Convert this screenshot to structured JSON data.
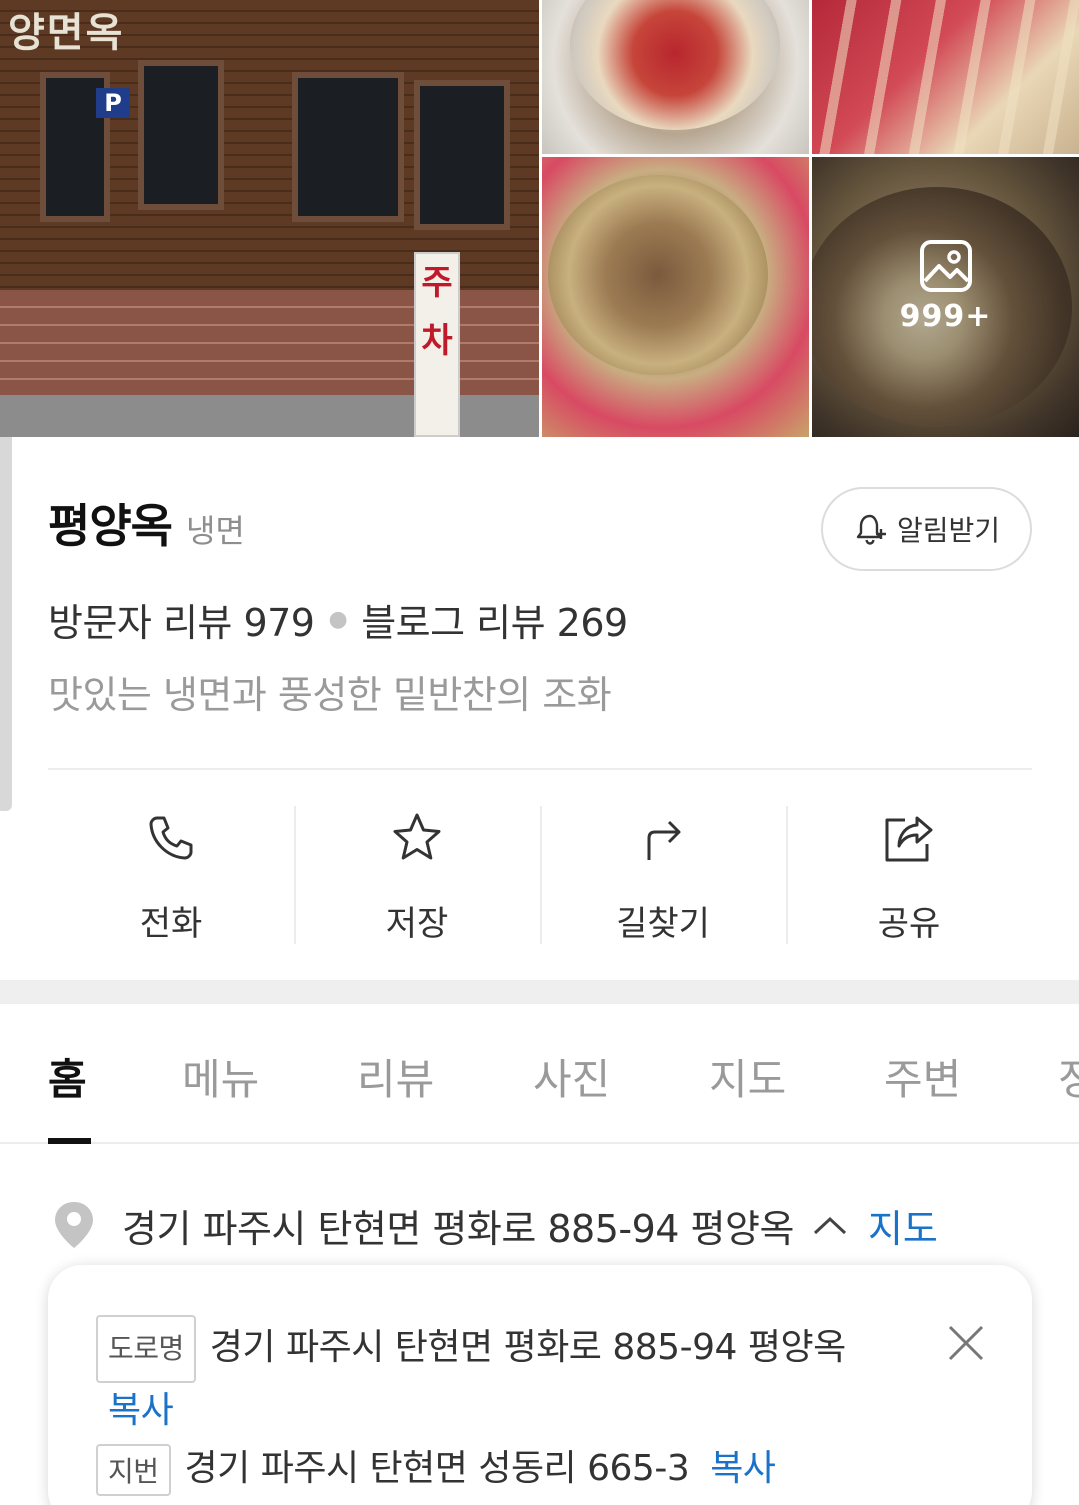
{
  "place": {
    "name": "평양옥",
    "category": "냉면",
    "alarm_label": "알림받기",
    "visitor_reviews": "방문자 리뷰 979",
    "blog_reviews": "블로그 리뷰 269",
    "description": "맛있는 냉면과 풍성한 밑반찬의 조화"
  },
  "photos": {
    "count_label": "999+",
    "signboard_chars": [
      "주",
      "차"
    ],
    "roof_text": "양면옥",
    "parking_mark": "P"
  },
  "actions": [
    {
      "label": "전화",
      "icon": "phone-icon"
    },
    {
      "label": "저장",
      "icon": "star-icon"
    },
    {
      "label": "길찾기",
      "icon": "directions-icon"
    },
    {
      "label": "공유",
      "icon": "share-icon"
    }
  ],
  "tabs": [
    {
      "label": "홈",
      "active": true
    },
    {
      "label": "메뉴"
    },
    {
      "label": "리뷰"
    },
    {
      "label": "사진"
    },
    {
      "label": "지도"
    },
    {
      "label": "주변"
    },
    {
      "label": "정"
    }
  ],
  "address": {
    "summary": "경기 파주시 탄현면 평화로 885-94 평양옥",
    "map_link": "지도",
    "road_badge": "도로명",
    "road_address": "경기 파주시 탄현면 평화로 885-94 평양옥",
    "lot_badge": "지번",
    "lot_address": "경기 파주시 탄현면 성동리 665-3",
    "copy_label": "복사"
  },
  "colors": {
    "link_blue": "#1a73c9",
    "text_dark": "#111111",
    "text_gray": "#9a9a9a",
    "divider": "#ececec"
  }
}
